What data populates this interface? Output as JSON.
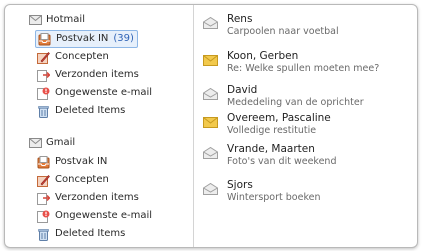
{
  "accounts": [
    {
      "name": "Hotmail",
      "folders": [
        {
          "label": "Postvak IN",
          "count": "(39)",
          "icon": "inbox-icon"
        },
        {
          "label": "Concepten",
          "icon": "drafts-icon"
        },
        {
          "label": "Verzonden items",
          "icon": "sent-icon"
        },
        {
          "label": "Ongewenste e-mail",
          "icon": "junk-icon"
        },
        {
          "label": "Deleted Items",
          "icon": "trash-icon"
        }
      ]
    },
    {
      "name": "Gmail",
      "folders": [
        {
          "label": "Postvak IN",
          "icon": "inbox-icon"
        },
        {
          "label": "Concepten",
          "icon": "drafts-icon"
        },
        {
          "label": "Verzonden items",
          "icon": "sent-icon"
        },
        {
          "label": "Ongewenste e-mail",
          "icon": "junk-icon"
        },
        {
          "label": "Deleted Items",
          "icon": "trash-icon"
        }
      ]
    }
  ],
  "messages": [
    {
      "sender": "Rens",
      "subject": "Carpoolen naar voetbal",
      "icon": "read-mail-icon"
    },
    {
      "sender": "Koon, Gerben",
      "subject": "Re: Welke spullen moeten mee?",
      "icon": "unread-mail-icon"
    },
    {
      "sender": "David",
      "subject": "Mededeling van de oprichter",
      "icon": "read-mail-icon"
    },
    {
      "sender": "Overeem, Pascaline",
      "subject": "Volledige restitutie",
      "icon": "unread-mail-icon"
    },
    {
      "sender": "Vrande, Maarten",
      "subject": "Foto's van dit weekend",
      "icon": "read-mail-icon"
    },
    {
      "sender": "Sjors",
      "subject": "Wintersport boeken",
      "icon": "read-mail-icon"
    }
  ],
  "colors": {
    "selection_bg": "#e7f0fb",
    "selection_border": "#8eb7e6",
    "count": "#2f63b6",
    "unread_envelope": "#f2c94c"
  }
}
